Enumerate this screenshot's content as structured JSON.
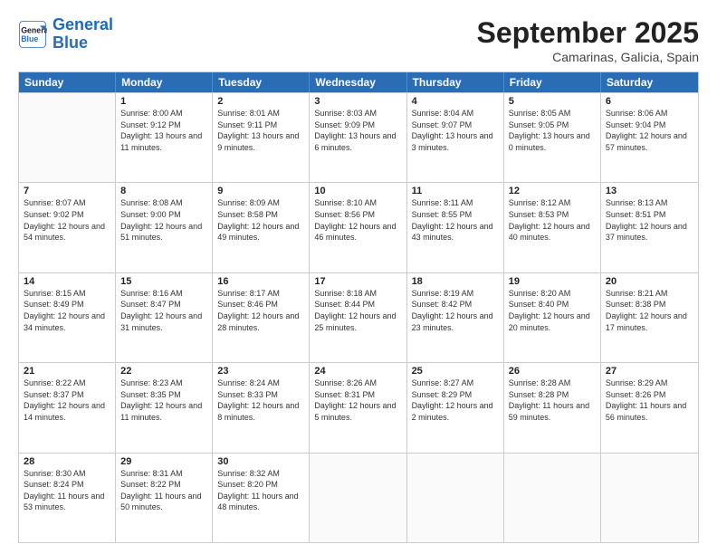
{
  "logo": {
    "line1": "General",
    "line2": "Blue"
  },
  "title": "September 2025",
  "location": "Camarinas, Galicia, Spain",
  "weekdays": [
    "Sunday",
    "Monday",
    "Tuesday",
    "Wednesday",
    "Thursday",
    "Friday",
    "Saturday"
  ],
  "weeks": [
    [
      {
        "day": "",
        "sunrise": "",
        "sunset": "",
        "daylight": ""
      },
      {
        "day": "1",
        "sunrise": "Sunrise: 8:00 AM",
        "sunset": "Sunset: 9:12 PM",
        "daylight": "Daylight: 13 hours and 11 minutes."
      },
      {
        "day": "2",
        "sunrise": "Sunrise: 8:01 AM",
        "sunset": "Sunset: 9:11 PM",
        "daylight": "Daylight: 13 hours and 9 minutes."
      },
      {
        "day": "3",
        "sunrise": "Sunrise: 8:03 AM",
        "sunset": "Sunset: 9:09 PM",
        "daylight": "Daylight: 13 hours and 6 minutes."
      },
      {
        "day": "4",
        "sunrise": "Sunrise: 8:04 AM",
        "sunset": "Sunset: 9:07 PM",
        "daylight": "Daylight: 13 hours and 3 minutes."
      },
      {
        "day": "5",
        "sunrise": "Sunrise: 8:05 AM",
        "sunset": "Sunset: 9:05 PM",
        "daylight": "Daylight: 13 hours and 0 minutes."
      },
      {
        "day": "6",
        "sunrise": "Sunrise: 8:06 AM",
        "sunset": "Sunset: 9:04 PM",
        "daylight": "Daylight: 12 hours and 57 minutes."
      }
    ],
    [
      {
        "day": "7",
        "sunrise": "Sunrise: 8:07 AM",
        "sunset": "Sunset: 9:02 PM",
        "daylight": "Daylight: 12 hours and 54 minutes."
      },
      {
        "day": "8",
        "sunrise": "Sunrise: 8:08 AM",
        "sunset": "Sunset: 9:00 PM",
        "daylight": "Daylight: 12 hours and 51 minutes."
      },
      {
        "day": "9",
        "sunrise": "Sunrise: 8:09 AM",
        "sunset": "Sunset: 8:58 PM",
        "daylight": "Daylight: 12 hours and 49 minutes."
      },
      {
        "day": "10",
        "sunrise": "Sunrise: 8:10 AM",
        "sunset": "Sunset: 8:56 PM",
        "daylight": "Daylight: 12 hours and 46 minutes."
      },
      {
        "day": "11",
        "sunrise": "Sunrise: 8:11 AM",
        "sunset": "Sunset: 8:55 PM",
        "daylight": "Daylight: 12 hours and 43 minutes."
      },
      {
        "day": "12",
        "sunrise": "Sunrise: 8:12 AM",
        "sunset": "Sunset: 8:53 PM",
        "daylight": "Daylight: 12 hours and 40 minutes."
      },
      {
        "day": "13",
        "sunrise": "Sunrise: 8:13 AM",
        "sunset": "Sunset: 8:51 PM",
        "daylight": "Daylight: 12 hours and 37 minutes."
      }
    ],
    [
      {
        "day": "14",
        "sunrise": "Sunrise: 8:15 AM",
        "sunset": "Sunset: 8:49 PM",
        "daylight": "Daylight: 12 hours and 34 minutes."
      },
      {
        "day": "15",
        "sunrise": "Sunrise: 8:16 AM",
        "sunset": "Sunset: 8:47 PM",
        "daylight": "Daylight: 12 hours and 31 minutes."
      },
      {
        "day": "16",
        "sunrise": "Sunrise: 8:17 AM",
        "sunset": "Sunset: 8:46 PM",
        "daylight": "Daylight: 12 hours and 28 minutes."
      },
      {
        "day": "17",
        "sunrise": "Sunrise: 8:18 AM",
        "sunset": "Sunset: 8:44 PM",
        "daylight": "Daylight: 12 hours and 25 minutes."
      },
      {
        "day": "18",
        "sunrise": "Sunrise: 8:19 AM",
        "sunset": "Sunset: 8:42 PM",
        "daylight": "Daylight: 12 hours and 23 minutes."
      },
      {
        "day": "19",
        "sunrise": "Sunrise: 8:20 AM",
        "sunset": "Sunset: 8:40 PM",
        "daylight": "Daylight: 12 hours and 20 minutes."
      },
      {
        "day": "20",
        "sunrise": "Sunrise: 8:21 AM",
        "sunset": "Sunset: 8:38 PM",
        "daylight": "Daylight: 12 hours and 17 minutes."
      }
    ],
    [
      {
        "day": "21",
        "sunrise": "Sunrise: 8:22 AM",
        "sunset": "Sunset: 8:37 PM",
        "daylight": "Daylight: 12 hours and 14 minutes."
      },
      {
        "day": "22",
        "sunrise": "Sunrise: 8:23 AM",
        "sunset": "Sunset: 8:35 PM",
        "daylight": "Daylight: 12 hours and 11 minutes."
      },
      {
        "day": "23",
        "sunrise": "Sunrise: 8:24 AM",
        "sunset": "Sunset: 8:33 PM",
        "daylight": "Daylight: 12 hours and 8 minutes."
      },
      {
        "day": "24",
        "sunrise": "Sunrise: 8:26 AM",
        "sunset": "Sunset: 8:31 PM",
        "daylight": "Daylight: 12 hours and 5 minutes."
      },
      {
        "day": "25",
        "sunrise": "Sunrise: 8:27 AM",
        "sunset": "Sunset: 8:29 PM",
        "daylight": "Daylight: 12 hours and 2 minutes."
      },
      {
        "day": "26",
        "sunrise": "Sunrise: 8:28 AM",
        "sunset": "Sunset: 8:28 PM",
        "daylight": "Daylight: 11 hours and 59 minutes."
      },
      {
        "day": "27",
        "sunrise": "Sunrise: 8:29 AM",
        "sunset": "Sunset: 8:26 PM",
        "daylight": "Daylight: 11 hours and 56 minutes."
      }
    ],
    [
      {
        "day": "28",
        "sunrise": "Sunrise: 8:30 AM",
        "sunset": "Sunset: 8:24 PM",
        "daylight": "Daylight: 11 hours and 53 minutes."
      },
      {
        "day": "29",
        "sunrise": "Sunrise: 8:31 AM",
        "sunset": "Sunset: 8:22 PM",
        "daylight": "Daylight: 11 hours and 50 minutes."
      },
      {
        "day": "30",
        "sunrise": "Sunrise: 8:32 AM",
        "sunset": "Sunset: 8:20 PM",
        "daylight": "Daylight: 11 hours and 48 minutes."
      },
      {
        "day": "",
        "sunrise": "",
        "sunset": "",
        "daylight": ""
      },
      {
        "day": "",
        "sunrise": "",
        "sunset": "",
        "daylight": ""
      },
      {
        "day": "",
        "sunrise": "",
        "sunset": "",
        "daylight": ""
      },
      {
        "day": "",
        "sunrise": "",
        "sunset": "",
        "daylight": ""
      }
    ]
  ]
}
